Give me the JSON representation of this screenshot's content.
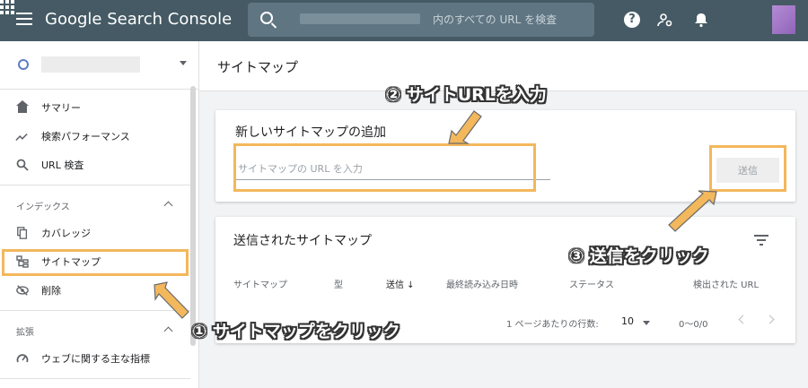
{
  "app": {
    "title": "Google Search Console"
  },
  "search": {
    "placeholder": "内のすべての URL を検査"
  },
  "sidebar": {
    "items": [
      {
        "label": "サマリー"
      },
      {
        "label": "検索パフォーマンス"
      },
      {
        "label": "URL 検査"
      }
    ],
    "index_section": {
      "title": "インデックス",
      "items": [
        {
          "label": "カバレッジ"
        },
        {
          "label": "サイトマップ"
        },
        {
          "label": "削除"
        }
      ]
    },
    "ext_section": {
      "title": "拡張",
      "items": [
        {
          "label": "ウェブに関する主な指標"
        }
      ]
    }
  },
  "main": {
    "title": "サイトマップ",
    "add_card": {
      "title": "新しいサイトマップの追加",
      "input_placeholder": "サイトマップの URL を入力",
      "submit_label": "送信"
    },
    "list_card": {
      "title": "送信されたサイトマップ",
      "columns": [
        "サイトマップ",
        "型",
        "送信 ↓",
        "最終読み込み日時",
        "ステータス",
        "検出された URL"
      ],
      "rows_per_page_label": "1 ページあたりの行数:",
      "rows_per_page_value": "10",
      "range": "0〜0/0"
    }
  },
  "annotations": {
    "step1": "① サイトマップをクリック",
    "step2": "② サイトURLを入力",
    "step3": "③ 送信をクリック",
    "color": "#f3b75c"
  }
}
